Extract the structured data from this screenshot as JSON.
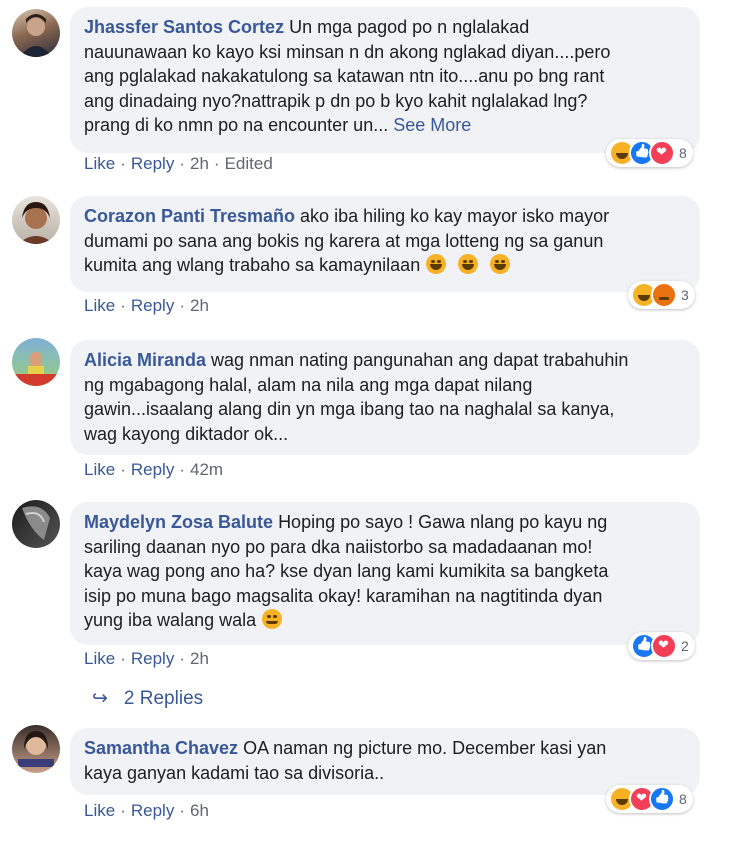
{
  "colors": {
    "link": "#385898",
    "bubble": "#f0f2f5",
    "meta": "#606770"
  },
  "comments": [
    {
      "author": "Jhassfer Santos Cortez",
      "text_lines": [
        "Un mga pagod po n nglalakad",
        "nauunawaan ko kayo ksi minsan n dn akong nglakad diyan....pero",
        "ang pglalakad nakakatulong sa katawan ntn ito....anu po bng rant",
        "ang dinadaing nyo?nattrapik p dn po b kyo kahit nglalakad lng?",
        "prang di ko nmn po na encounter un..."
      ],
      "see_more": "See More",
      "like": "Like",
      "reply": "Reply",
      "time": "2h",
      "edited": "Edited",
      "reactions": [
        "haha-icon",
        "like-icon",
        "love-icon"
      ],
      "reaction_count": "8"
    },
    {
      "author": "Corazon Panti Tresmaño",
      "text_lines": [
        "ako iba hiling ko kay mayor isko mayor",
        "dumami po sana ang bokis ng karera at mga lotteng ng sa ganun",
        "kumita ang wlang trabaho sa kamaynilaan"
      ],
      "like": "Like",
      "reply": "Reply",
      "time": "2h",
      "reactions": [
        "haha-icon",
        "angry-icon"
      ],
      "reaction_count": "3"
    },
    {
      "author": "Alicia Miranda",
      "text_lines": [
        "wag nman nating pangunahan ang dapat trabahuhin",
        "ng mgabagong halal, alam na nila ang mga dapat nilang",
        "gawin...isaalang alang din yn mga ibang tao na naghalal sa kanya,",
        "wag kayong diktador ok..."
      ],
      "like": "Like",
      "reply": "Reply",
      "time": "42m"
    },
    {
      "author": "Maydelyn Zosa Balute",
      "text_lines": [
        "Hoping po sayo ! Gawa nlang po kayu ng",
        "sariling daanan nyo po para dka naiistorbo sa madadaanan mo!",
        "kaya wag pong ano ha? kse dyan lang kami kumikita sa bangketa",
        "isip po muna bago magsalita okay! karamihan na nagtitinda dyan",
        "yung iba walang wala"
      ],
      "like": "Like",
      "reply": "Reply",
      "time": "2h",
      "reactions": [
        "like-icon",
        "love-icon"
      ],
      "reaction_count": "2",
      "replies_label": "2 Replies"
    },
    {
      "author": "Samantha Chavez",
      "text_lines": [
        "OA naman ng picture mo. December kasi yan",
        "kaya ganyan kadami tao sa divisoria.."
      ],
      "like": "Like",
      "reply": "Reply",
      "time": "6h",
      "reactions": [
        "haha-icon",
        "love-icon",
        "like-icon"
      ],
      "reaction_count": "8"
    }
  ]
}
